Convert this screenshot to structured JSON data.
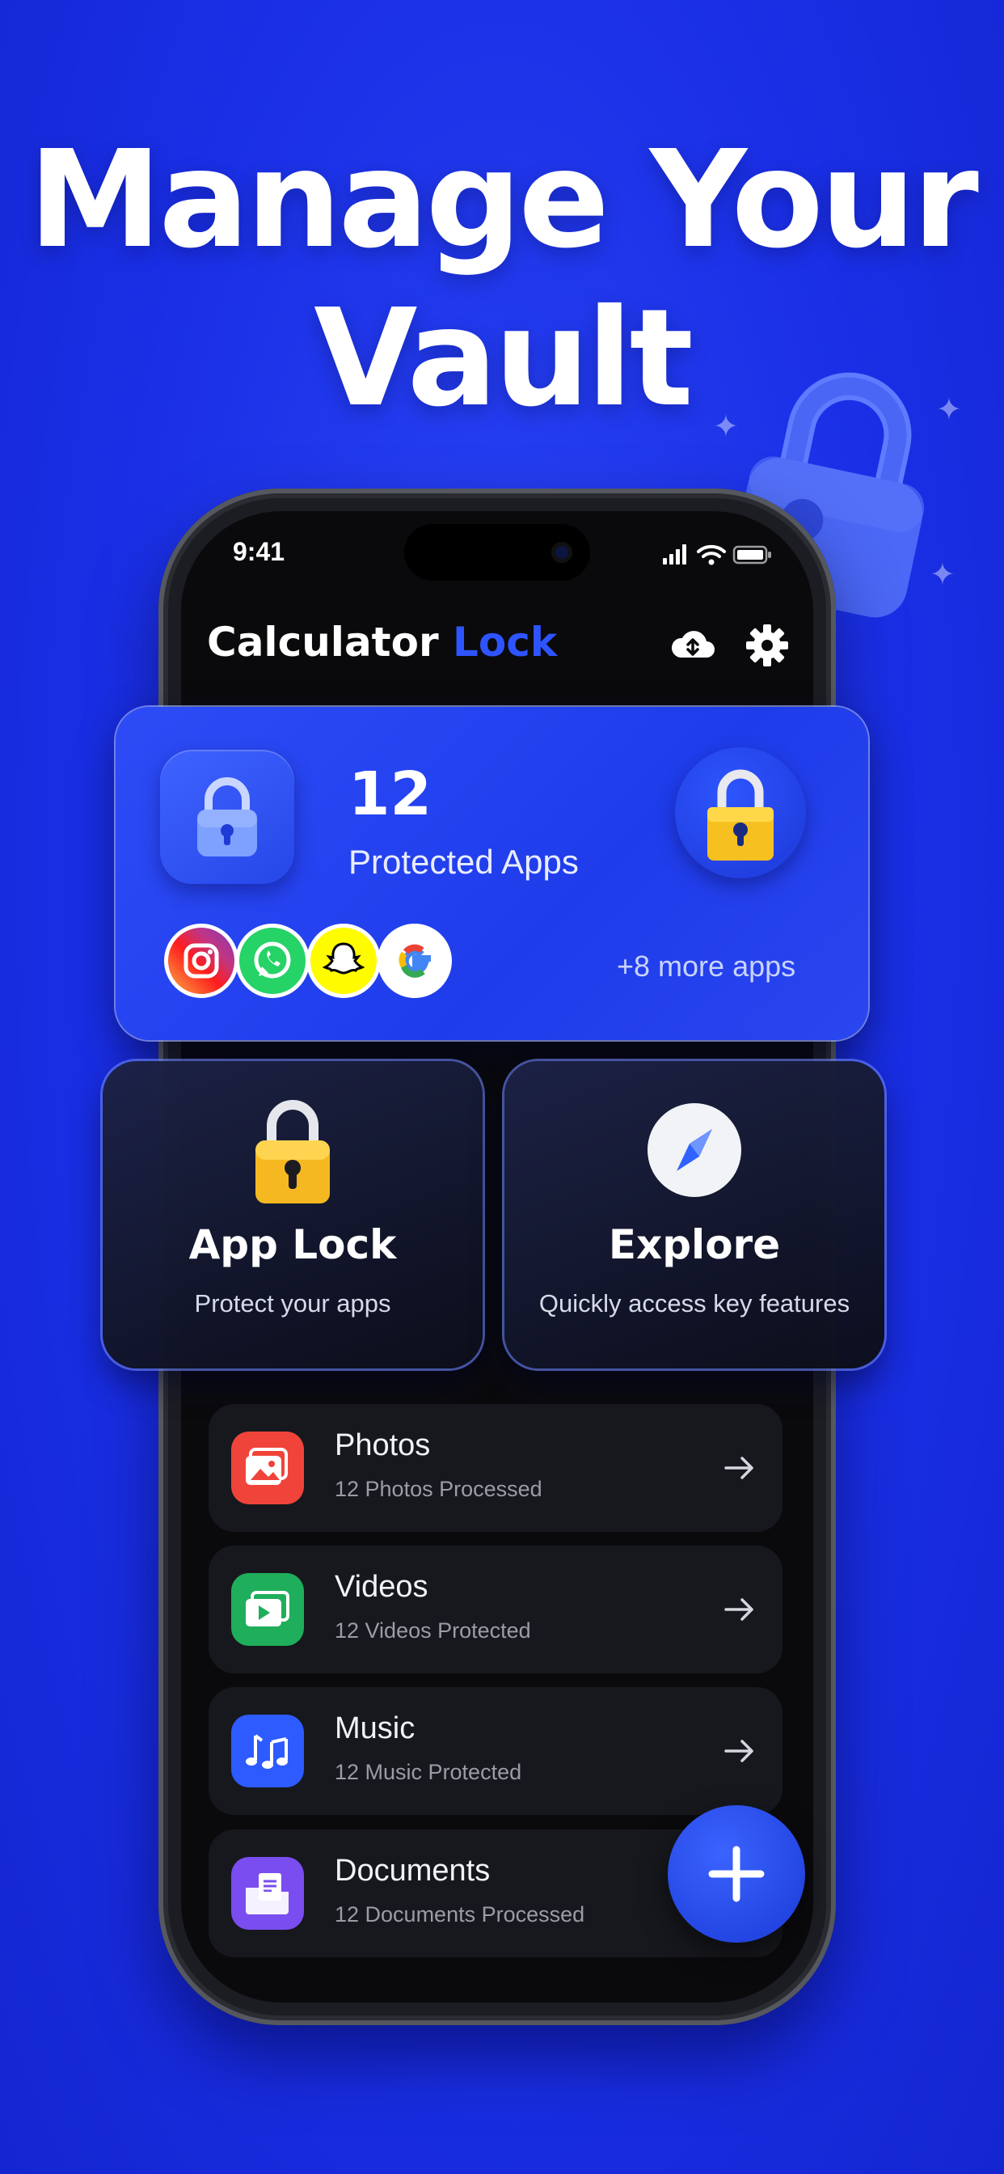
{
  "headline": {
    "line1": "Manage Your",
    "line2": "Vault"
  },
  "status_bar": {
    "time": "9:41"
  },
  "header": {
    "title_main": "Calculator",
    "title_accent": "Lock"
  },
  "protected": {
    "count": "12",
    "label": "Protected Apps",
    "more": "+8 more apps",
    "apps": [
      "instagram-icon",
      "whatsapp-icon",
      "snapchat-icon",
      "google-icon"
    ]
  },
  "tiles": [
    {
      "title": "App Lock",
      "subtitle": "Protect your apps"
    },
    {
      "title": "Explore",
      "subtitle": "Quickly access key features"
    }
  ],
  "list": [
    {
      "title": "Photos",
      "subtitle": "12 Photos Processed",
      "color": "#f0443a"
    },
    {
      "title": "Videos",
      "subtitle": "12 Videos Protected",
      "color": "#1fae5b"
    },
    {
      "title": "Music",
      "subtitle": "12 Music Protected",
      "color": "#2d5bff"
    },
    {
      "title": "Documents",
      "subtitle": "12 Documents Processed",
      "color": "#7a4df0"
    }
  ],
  "colors": {
    "background": "#1a2fe6",
    "accent": "#2e54ff",
    "lock_yellow": "#f5c020"
  }
}
